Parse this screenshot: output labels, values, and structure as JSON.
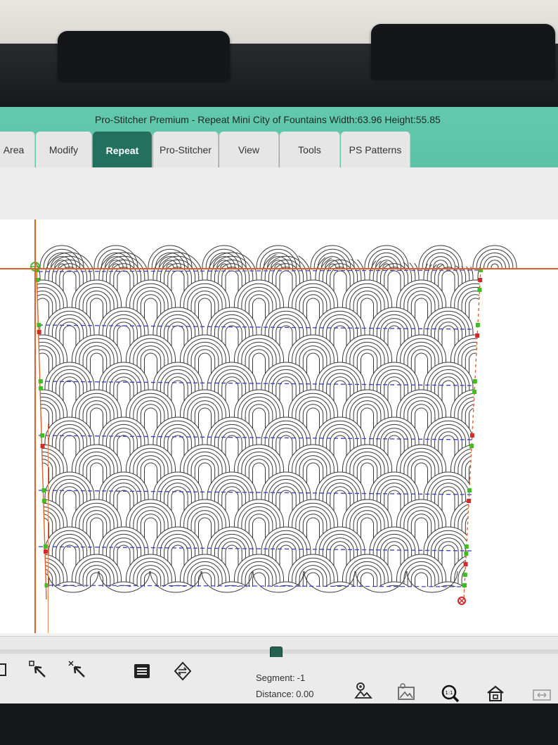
{
  "window": {
    "title": "Pro-Stitcher Premium  -  Repeat Mini City of Fountains  Width:63.96  Height:55.85"
  },
  "tabs": [
    {
      "label": "Area",
      "active": false
    },
    {
      "label": "Modify",
      "active": false
    },
    {
      "label": "Repeat",
      "active": true
    },
    {
      "label": "Pro-Stitcher",
      "active": false
    },
    {
      "label": "View",
      "active": false
    },
    {
      "label": "Tools",
      "active": false
    },
    {
      "label": "PS Patterns",
      "active": false
    }
  ],
  "canvas": {
    "pattern": "city-of-fountains arches",
    "colors": {
      "stitch_line": "#3a3a3a",
      "guide_line": "#e0612b",
      "seam_dash": "#3b3fc2",
      "node_green": "#3fbf1f",
      "node_red": "#d42a2a"
    }
  },
  "status": {
    "segment_label": "Segment:",
    "segment_value": "-1",
    "distance_label": "Distance:",
    "distance_value": "0.00"
  },
  "toolbar": {
    "icons": [
      "select-node-icon",
      "select-arrow-icon",
      "deselect-arrow-icon",
      "stitch-list-icon",
      "swap-icon",
      "zoom-image-icon",
      "background-image-icon",
      "zoom-1to1-icon",
      "home-icon",
      "fit-view-icon"
    ]
  },
  "scroll": {
    "position_fraction": 0.49
  }
}
